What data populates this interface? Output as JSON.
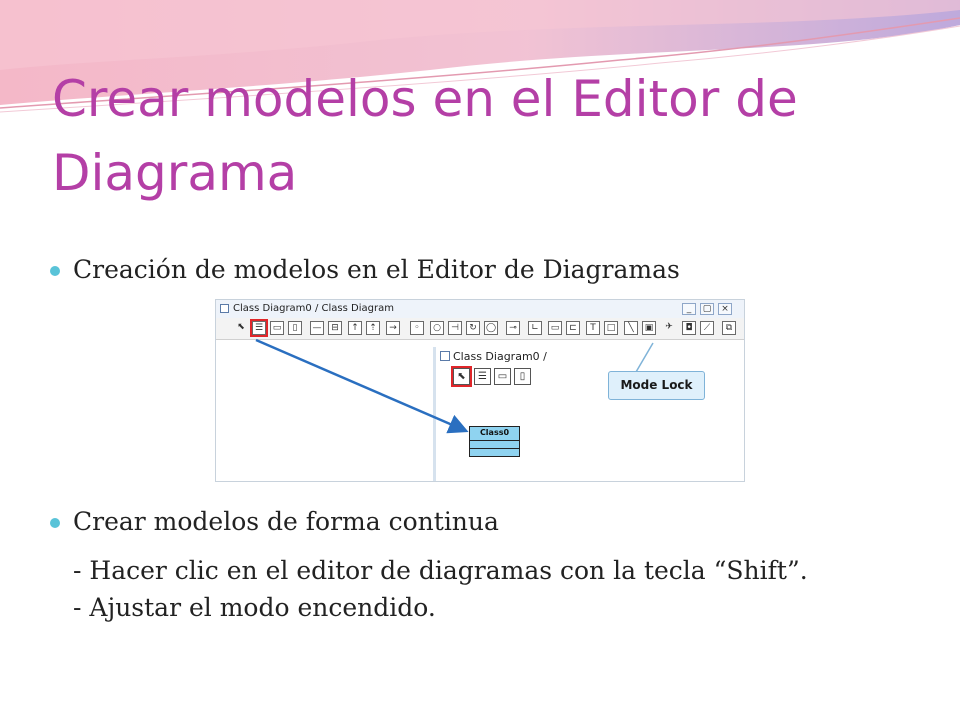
{
  "slide": {
    "title": "Crear modelos en el Editor de Diagrama",
    "bullets": [
      {
        "text": "Creación de modelos en el Editor de Diagramas"
      },
      {
        "text": "Crear modelos de forma continua"
      }
    ],
    "sub_lines": [
      "- Hacer clic en el editor de diagramas con la tecla “Shift”.",
      "- Ajustar el modo encendido."
    ]
  },
  "screenshot": {
    "window_title": "Class Diagram0 / Class Diagram",
    "inner_title": "Class Diagram0 /",
    "window_buttons": [
      "_",
      "▢",
      "×"
    ],
    "class_name": "Class0",
    "callout_label": "Mode Lock"
  },
  "colors": {
    "title": "#b43fa6",
    "bullet": "#59c3d8",
    "highlight": "#e0262a",
    "arrow": "#2a6fc0",
    "class_fill": "#8fd3f0"
  }
}
